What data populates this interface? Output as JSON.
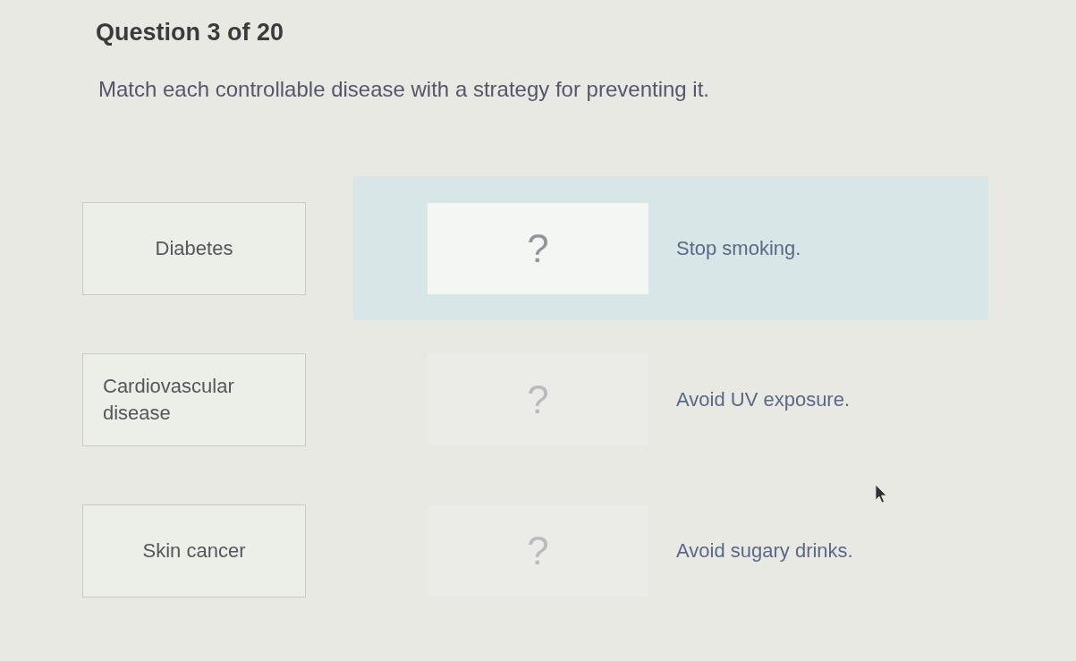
{
  "question": {
    "title": "Question 3 of 20",
    "prompt": "Match each controllable disease with a strategy for preventing it."
  },
  "pairs": [
    {
      "term": "Diabetes",
      "answer": "?",
      "strategy": "Stop smoking.",
      "selected": true
    },
    {
      "term": "Cardiovascular disease",
      "answer": "?",
      "strategy": "Avoid UV exposure.",
      "selected": false
    },
    {
      "term": "Skin cancer",
      "answer": "?",
      "strategy": "Avoid sugary drinks.",
      "selected": false
    }
  ]
}
